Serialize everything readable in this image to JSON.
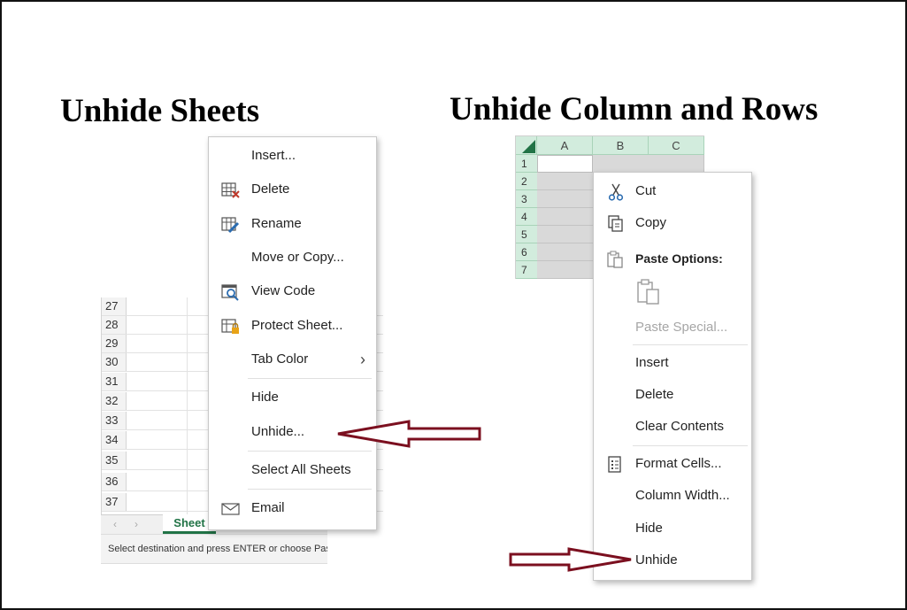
{
  "headings": {
    "left": "Unhide Sheets",
    "right": "Unhide Column and Rows"
  },
  "sheet": {
    "row_numbers": [
      "27",
      "28",
      "29",
      "30",
      "31",
      "32",
      "33",
      "34",
      "35",
      "36",
      "37"
    ],
    "tab_label": "Sheet",
    "nav_prev": "‹",
    "nav_next": "›",
    "status_text": "Select destination and press ENTER or choose Paste"
  },
  "sheet_menu": {
    "insert": "Insert...",
    "delete": "Delete",
    "rename": "Rename",
    "move_copy": "Move or Copy...",
    "view_code": "View Code",
    "protect_sheet": "Protect Sheet...",
    "tab_color": "Tab Color",
    "tab_color_chevron": "›",
    "hide": "Hide",
    "unhide": "Unhide...",
    "select_all_sheets": "Select All Sheets",
    "email": "Email"
  },
  "grid": {
    "columns": [
      "A",
      "B",
      "C"
    ],
    "rows": [
      "1",
      "2",
      "3",
      "4",
      "5",
      "6",
      "7"
    ]
  },
  "cell_menu": {
    "cut": "Cut",
    "copy": "Copy",
    "paste_options": "Paste Options:",
    "paste_special": "Paste Special...",
    "insert": "Insert",
    "delete": "Delete",
    "clear_contents": "Clear Contents",
    "format_cells": "Format Cells...",
    "column_width": "Column Width...",
    "hide": "Hide",
    "unhide": "Unhide"
  },
  "colors": {
    "arrow": "#7b0f1f",
    "excel_green": "#217346",
    "header_green": "#d2ecdd"
  },
  "icons": {
    "delete": "delete-sheet-icon",
    "rename": "rename-sheet-icon",
    "view_code": "view-code-icon",
    "protect": "protect-sheet-icon",
    "email": "email-icon",
    "cut": "scissors-icon",
    "copy": "copy-icon",
    "paste": "clipboard-icon",
    "format_cells": "format-cells-icon"
  }
}
